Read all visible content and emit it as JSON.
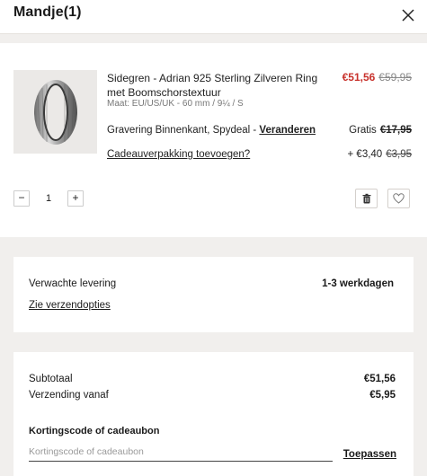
{
  "header": {
    "title": "Mandje(1)",
    "close_icon": "close-icon"
  },
  "item": {
    "image_icon": "ring-image",
    "name": "Sidegren - Adrian 925 Sterling Zilveren Ring met Boomschorstextuur",
    "meta": "Maat: EU/US/UK - 60 mm / 9¼ / S",
    "price_now": "€51,56",
    "price_was": "€59,95",
    "engraving_label": "Gravering Binnenkant, Spydeal - ",
    "engraving_link": "Veranderen",
    "engraving_price": "Gratis",
    "engraving_was": "€17,95",
    "gift_link": "Cadeauverpakking toevoegen?",
    "gift_price": "+ €3,40",
    "gift_was": "€3,95",
    "quantity": "1",
    "minus_label": "−",
    "plus_label": "+",
    "delete_icon": "trash-icon",
    "wishlist_icon": "heart-icon"
  },
  "delivery": {
    "label": "Verwachte levering",
    "value": "1-3 werkdagen",
    "link": "Zie verzendopties"
  },
  "summary": {
    "subtotal_label": "Subtotaal",
    "subtotal_value": "€51,56",
    "shipping_label": "Verzending vanaf",
    "shipping_value": "€5,95",
    "coupon_label": "Kortingscode of cadeaubon",
    "coupon_placeholder": "Kortingscode of cadeaubon",
    "apply_label": "Toepassen"
  },
  "colors": {
    "background": "#f1efed",
    "sale_red": "#c8322c"
  }
}
